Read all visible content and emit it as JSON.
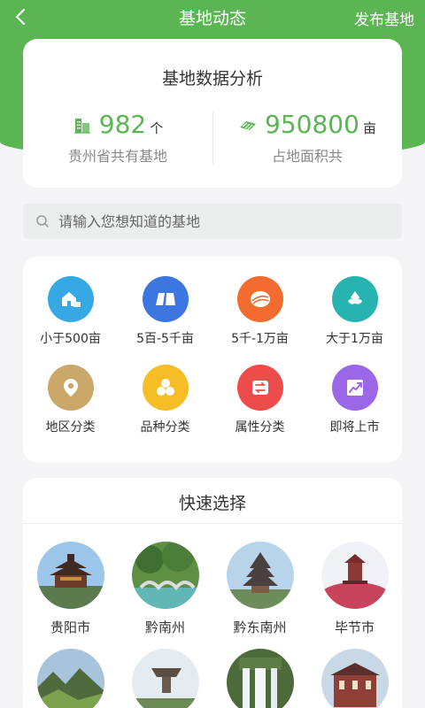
{
  "header": {
    "back_icon": "chevron-left-icon",
    "title": "基地动态",
    "action": "发布基地"
  },
  "stats": {
    "title": "基地数据分析",
    "bases": {
      "icon": "building-icon",
      "value": "982",
      "unit": "个",
      "label": "贵州省共有基地"
    },
    "area": {
      "icon": "land-icon",
      "value": "950800",
      "unit": "亩",
      "label": "占地面积共"
    }
  },
  "search": {
    "icon": "search-icon",
    "placeholder": "请输入您想知道的基地"
  },
  "categories": [
    {
      "label": "小于500亩",
      "icon": "farmhouse-icon",
      "color": "#36a8e4"
    },
    {
      "label": "5百-5千亩",
      "icon": "field-icon",
      "color": "#3c76e0"
    },
    {
      "label": "5千-1万亩",
      "icon": "terrace-icon",
      "color": "#f26b2f"
    },
    {
      "label": "大于1万亩",
      "icon": "plant-icon",
      "color": "#27b4b0"
    },
    {
      "label": "地区分类",
      "icon": "location-icon",
      "color": "#c9a86a"
    },
    {
      "label": "品种分类",
      "icon": "variety-icon",
      "color": "#f5bd26"
    },
    {
      "label": "属性分类",
      "icon": "attribute-icon",
      "color": "#ee4b4b"
    },
    {
      "label": "即将上市",
      "icon": "trend-up-icon",
      "color": "#9c67e6"
    }
  ],
  "quick": {
    "title": "快速选择",
    "cities": [
      {
        "label": "贵阳市"
      },
      {
        "label": "黔南州"
      },
      {
        "label": "黔东南州"
      },
      {
        "label": "毕节市"
      },
      {
        "label": ""
      },
      {
        "label": ""
      },
      {
        "label": ""
      },
      {
        "label": ""
      }
    ]
  },
  "colors": {
    "brand": "#5ab552",
    "text": "#333333",
    "muted": "#888888"
  }
}
